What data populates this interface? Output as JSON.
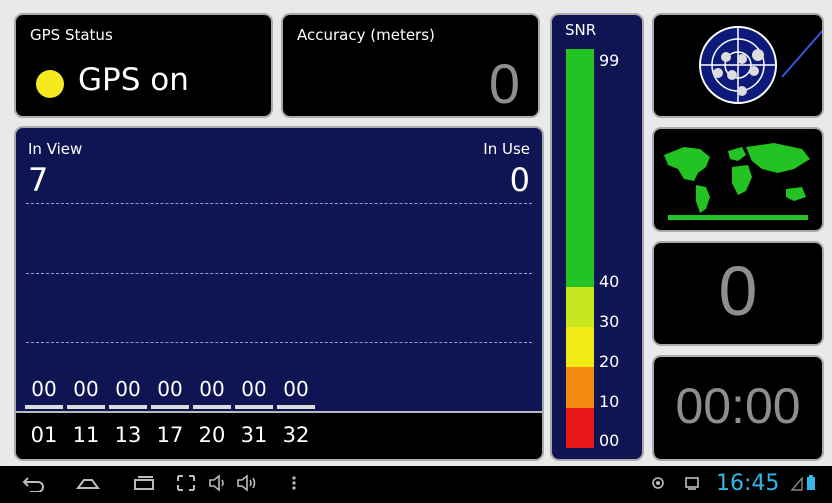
{
  "gps_status": {
    "label": "GPS Status",
    "state": "GPS on",
    "indicator_color": "#f4ea1e"
  },
  "accuracy": {
    "label": "Accuracy (meters)",
    "value": "0"
  },
  "satellites": {
    "in_view_label": "In View",
    "in_view": "7",
    "in_use_label": "In Use",
    "in_use": "0",
    "snr_values": [
      "00",
      "00",
      "00",
      "00",
      "00",
      "00",
      "00"
    ],
    "prns": [
      "01",
      "11",
      "13",
      "17",
      "20",
      "31",
      "32"
    ]
  },
  "snr_scale": {
    "title": "SNR",
    "ticks": [
      "99",
      "40",
      "30",
      "20",
      "10",
      "00"
    ]
  },
  "count": {
    "value": "0"
  },
  "fix_time": {
    "value": "00:00"
  },
  "system_bar": {
    "clock": "16:45",
    "clock_color": "#33b5e5"
  }
}
